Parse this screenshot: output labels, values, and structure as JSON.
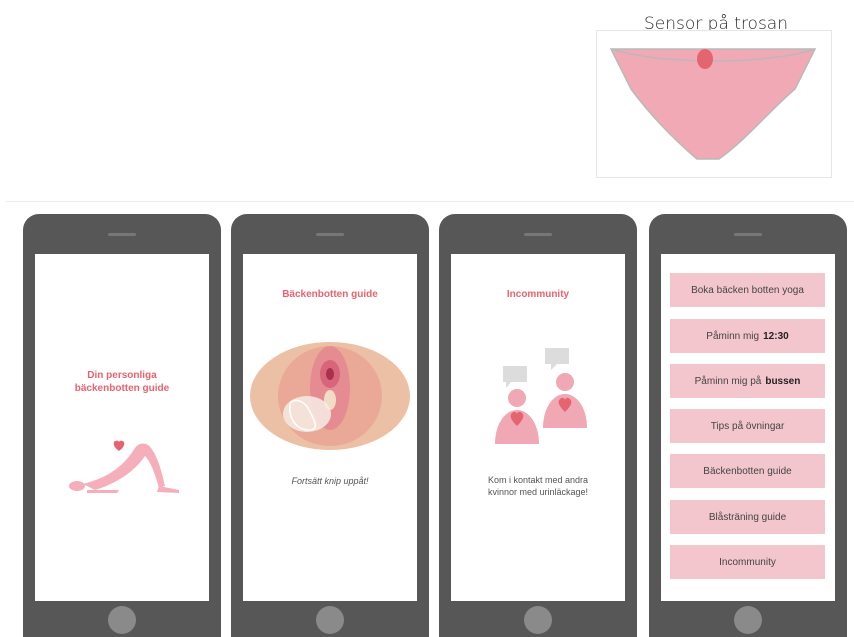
{
  "sensor": {
    "title": "Sensor på trosan"
  },
  "phones": [
    {
      "title": "Din personliga",
      "title2": "bäckenbotten guide"
    },
    {
      "title": "Bäckenbotten guide",
      "caption": "Fortsätt knip uppåt!"
    },
    {
      "title": "Incommunity",
      "caption1": "Kom i kontakt med andra",
      "caption2": "kvinnor med urinläckage!"
    },
    {
      "menu": [
        {
          "label": "Boka bäcken botten yoga",
          "bold": ""
        },
        {
          "label": "Påminn mig",
          "bold": "12:30"
        },
        {
          "label": "Påminn mig på",
          "bold": "bussen"
        },
        {
          "label": "Tips på övningar",
          "bold": ""
        },
        {
          "label": "Bäckenbotten guide",
          "bold": ""
        },
        {
          "label": "Blåsträning guide",
          "bold": ""
        },
        {
          "label": "Incommunity",
          "bold": ""
        }
      ]
    }
  ],
  "colors": {
    "accent": "#e8636f",
    "pink": "#f3c6cd",
    "phone": "#575757"
  },
  "icons": [
    "panties-sensor-icon",
    "heart-icon",
    "yoga-bridge-pose-icon",
    "pelvic-anatomy-icon",
    "chat-bubble-icon",
    "person-icon"
  ]
}
